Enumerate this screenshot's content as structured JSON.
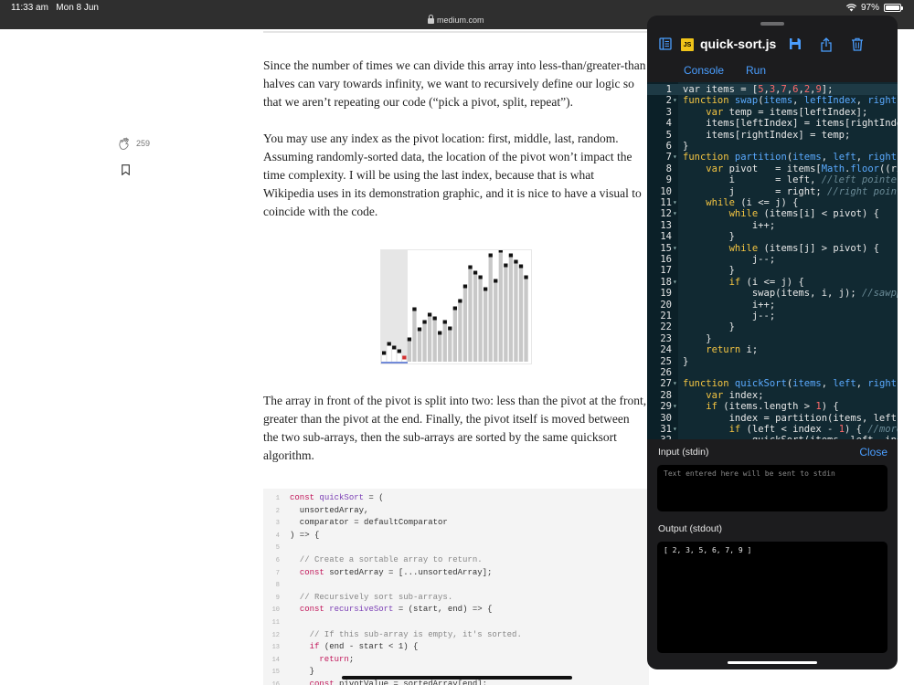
{
  "status": {
    "time": "11:33 am",
    "date": "Mon 8 Jun",
    "battery": "97%",
    "battery_level": 0.97
  },
  "browser": {
    "url": "medium.com"
  },
  "article": {
    "paragraphs": [
      "Since the number of times we can divide this array into less-than/greater-than halves can vary towards infinity, we want to recursively define our logic so that we aren’t repeating our code (“pick a pivot, split, repeat”).",
      "You may use any index as the pivot location: first, middle, last, random. Assuming randomly-sorted data, the location of the pivot won’t impact the time complexity. I will be using the last index, because that is what Wikipedia uses in its demonstration graphic, and it is nice to have a visual to coincide with the code.",
      "The array in front of the pivot is split into two: less than the pivot at the front, greater than the pivot at the end. Finally, the pivot itself is moved between the two sub-arrays, then the sub-arrays are sorted by the same quicksort algorithm."
    ],
    "clap_count": "259",
    "code_lines": [
      {
        "n": "1",
        "t": "const quickSort = ("
      },
      {
        "n": "2",
        "t": "  unsortedArray,"
      },
      {
        "n": "3",
        "t": "  comparator = defaultComparator"
      },
      {
        "n": "4",
        "t": ") => {"
      },
      {
        "n": "5",
        "t": ""
      },
      {
        "n": "6",
        "t": "  // Create a sortable array to return."
      },
      {
        "n": "7",
        "t": "  const sortedArray = [...unsortedArray];"
      },
      {
        "n": "8",
        "t": ""
      },
      {
        "n": "9",
        "t": "  // Recursively sort sub-arrays."
      },
      {
        "n": "10",
        "t": "  const recursiveSort = (start, end) => {"
      },
      {
        "n": "11",
        "t": ""
      },
      {
        "n": "12",
        "t": "    // If this sub-array is empty, it's sorted."
      },
      {
        "n": "13",
        "t": "    if (end - start < 1) {"
      },
      {
        "n": "14",
        "t": "      return;"
      },
      {
        "n": "15",
        "t": "    }"
      },
      {
        "n": "16",
        "t": "    const pivotValue = sortedArray[end];"
      }
    ]
  },
  "sort_graphic": {
    "bar_values": [
      10,
      20,
      16,
      12,
      5,
      25,
      58,
      36,
      44,
      52,
      48,
      32,
      44,
      37,
      59,
      67,
      83,
      104,
      98,
      93,
      80,
      117,
      89,
      122,
      106,
      117,
      110,
      105,
      93
    ]
  },
  "editor": {
    "file_name": "quick-sort.js",
    "badge": "JS",
    "tabs": [
      "Console",
      "Run"
    ],
    "lines": [
      {
        "n": "1",
        "f": "",
        "h": "<span>var items = [</span><span class='nm'>5</span>,<span class='nm'>3</span>,<span class='nm'>7</span>,<span class='nm'>6</span>,<span class='nm'>2</span>,<span class='nm'>9</span>];"
      },
      {
        "n": "2",
        "f": "▾",
        "h": "<span class='kw'>function</span> <span class='fn'>swap</span>(<span class='fn'>items</span>, <span class='fn'>leftIndex</span>, <span class='fn'>rightI</span>"
      },
      {
        "n": "3",
        "f": "",
        "h": "    <span class='kw'>var</span> temp = items[leftIndex];"
      },
      {
        "n": "4",
        "f": "",
        "h": "    items[leftIndex] = items[rightInde"
      },
      {
        "n": "5",
        "f": "",
        "h": "    items[rightIndex] = temp;"
      },
      {
        "n": "6",
        "f": "",
        "h": "}"
      },
      {
        "n": "7",
        "f": "▾",
        "h": "<span class='kw'>function</span> <span class='fn'>partition</span>(<span class='fn'>items</span>, <span class='fn'>left</span>, <span class='fn'>right</span>)"
      },
      {
        "n": "8",
        "f": "",
        "h": "    <span class='kw'>var</span> pivot   = items[<span class='fn'>Math</span>.<span class='fn'>floor</span>((ri"
      },
      {
        "n": "9",
        "f": "",
        "h": "        i       = left, <span class='cm'>//left pointer</span>"
      },
      {
        "n": "10",
        "f": "",
        "h": "        j       = right; <span class='cm'>//right point</span>"
      },
      {
        "n": "11",
        "f": "▾",
        "h": "    <span class='kw'>while</span> (i &lt;= j) {"
      },
      {
        "n": "12",
        "f": "▾",
        "h": "        <span class='kw'>while</span> (items[i] &lt; pivot) {"
      },
      {
        "n": "13",
        "f": "",
        "h": "            i++;"
      },
      {
        "n": "14",
        "f": "",
        "h": "        }"
      },
      {
        "n": "15",
        "f": "▾",
        "h": "        <span class='kw'>while</span> (items[j] &gt; pivot) {"
      },
      {
        "n": "16",
        "f": "",
        "h": "            j--;"
      },
      {
        "n": "17",
        "f": "",
        "h": "        }"
      },
      {
        "n": "18",
        "f": "▾",
        "h": "        <span class='kw'>if</span> (i &lt;= j) {"
      },
      {
        "n": "19",
        "f": "",
        "h": "            swap(items, i, j); <span class='cm'>//sawpp</span>"
      },
      {
        "n": "20",
        "f": "",
        "h": "            i++;"
      },
      {
        "n": "21",
        "f": "",
        "h": "            j--;"
      },
      {
        "n": "22",
        "f": "",
        "h": "        }"
      },
      {
        "n": "23",
        "f": "",
        "h": "    }"
      },
      {
        "n": "24",
        "f": "",
        "h": "    <span class='kw'>return</span> i;"
      },
      {
        "n": "25",
        "f": "",
        "h": "}"
      },
      {
        "n": "26",
        "f": "",
        "h": ""
      },
      {
        "n": "27",
        "f": "▾",
        "h": "<span class='kw'>function</span> <span class='fn'>quickSort</span>(<span class='fn'>items</span>, <span class='fn'>left</span>, <span class='fn'>right</span>)"
      },
      {
        "n": "28",
        "f": "",
        "h": "    <span class='kw'>var</span> index;"
      },
      {
        "n": "29",
        "f": "▾",
        "h": "    <span class='kw'>if</span> (items.length &gt; <span class='nm'>1</span>) {"
      },
      {
        "n": "30",
        "f": "",
        "h": "        index = partition(items, left,"
      },
      {
        "n": "31",
        "f": "▾",
        "h": "        <span class='kw'>if</span> (left &lt; index - <span class='nm'>1</span>) { <span class='cm'>//more</span>"
      },
      {
        "n": "32",
        "f": "",
        "h": "            quickSort(items, left, ind"
      }
    ],
    "stdin_label": "Input (stdin)",
    "close_label": "Close",
    "stdin_placeholder": "Text entered here will be sent to stdin",
    "stdout_label": "Output (stdout)",
    "stdout_value": "[ 2, 3, 5, 6, 7, 9 ]"
  },
  "colors": {
    "accent": "#4a9eff",
    "editor_bg": "#112932",
    "keyword": "#f4c542",
    "function": "#5aaaff",
    "number": "#ff6b6b"
  }
}
